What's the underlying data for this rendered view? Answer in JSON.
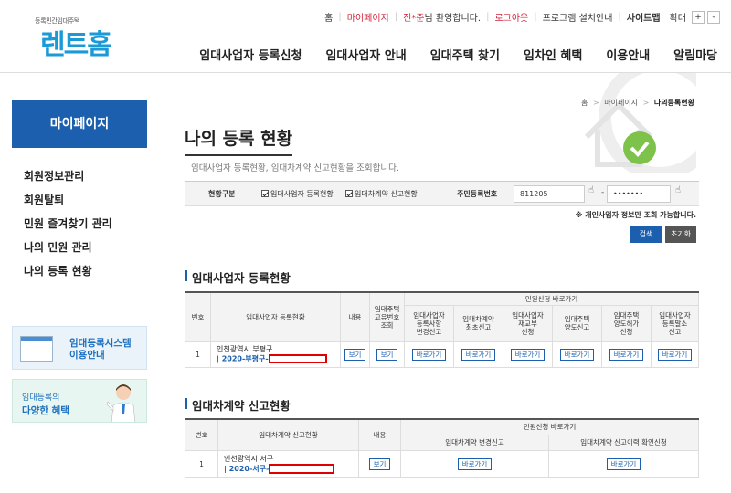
{
  "header": {
    "logo_small": "등록민간임대주택",
    "logo_text": "렌트홈",
    "util": {
      "home": "홈",
      "mypage": "마이페이지",
      "user_name": "전*준",
      "welcome": "님 환영합니다.",
      "logout": "로그아웃",
      "program": "프로그램 설치안내",
      "sitemap": "사이트맵",
      "zoom": "확대",
      "zoom_in": "+",
      "zoom_out": "-"
    },
    "gnb": [
      "임대사업자 등록신청",
      "임대사업자 안내",
      "임대주택 찾기",
      "임차인 혜택",
      "이용안내",
      "알림마당"
    ]
  },
  "sidebar": {
    "title": "마이페이지",
    "items": [
      {
        "label": "회원정보관리"
      },
      {
        "label": "회원탈퇴"
      },
      {
        "label": "민원 즐겨찾기 관리"
      },
      {
        "label": "나의 민원 관리"
      },
      {
        "label": "나의 등록 현황"
      }
    ],
    "banner1": {
      "line1": "임대등록시스템",
      "line2": "이용안내"
    },
    "banner2": {
      "line1": "임대등록의",
      "line2": "다양한 혜택"
    }
  },
  "content": {
    "breadcrumb": {
      "home": "홈",
      "sep": ">",
      "parent": "마이페이지",
      "current": "나의등록현황"
    },
    "title": "나의 등록 현황",
    "description": "임대사업자 등록현황, 임대차계약 신고현황을 조회합니다.",
    "search": {
      "type_label": "현황구분",
      "check1": "임대사업자 등록현황",
      "check2": "임대차계약 신고현황",
      "rrn_label": "주민등록번호",
      "rrn_front": "811205",
      "rrn_sep": "-",
      "rrn_back": "•••••••",
      "note": "※ 개인사업자 정보만 조회 가능합니다.",
      "search_btn": "검색",
      "reset_btn": "초기화"
    },
    "section1": {
      "title": "임대사업자 등록현황",
      "headers": {
        "no": "번호",
        "status": "임대사업자 등록현황",
        "content": "내용",
        "unique": "임대주택\n고유번호\n조회",
        "shortcut": "민원신청 바로가기",
        "sub": [
          "임대사업자\n등록사항\n변경신고",
          "임대차계약\n최초신고",
          "임대사업자\n재교부\n신청",
          "임대주택\n양도신고",
          "임대주택\n양도허가\n신청",
          "임대사업자\n등록말소\n신고"
        ]
      },
      "rows": [
        {
          "no": "1",
          "addr": "인천광역시 부평구",
          "num_prefix": "| 2020-부평구-",
          "view": "보기",
          "view2": "보기",
          "go": "바로가기"
        }
      ]
    },
    "section2": {
      "title": "임대차계약 신고현황",
      "headers": {
        "no": "번호",
        "status": "임대차계약 신고현황",
        "content": "내용",
        "shortcut": "민원신청 바로가기",
        "sub": [
          "임대차계약 변경신고",
          "임대차계약 신고이력 확인신청"
        ]
      },
      "rows": [
        {
          "no": "1",
          "addr": "인천광역시 서구",
          "num_prefix": "| 2020-서구-",
          "view": "보기",
          "go": "바로가기"
        }
      ]
    }
  }
}
